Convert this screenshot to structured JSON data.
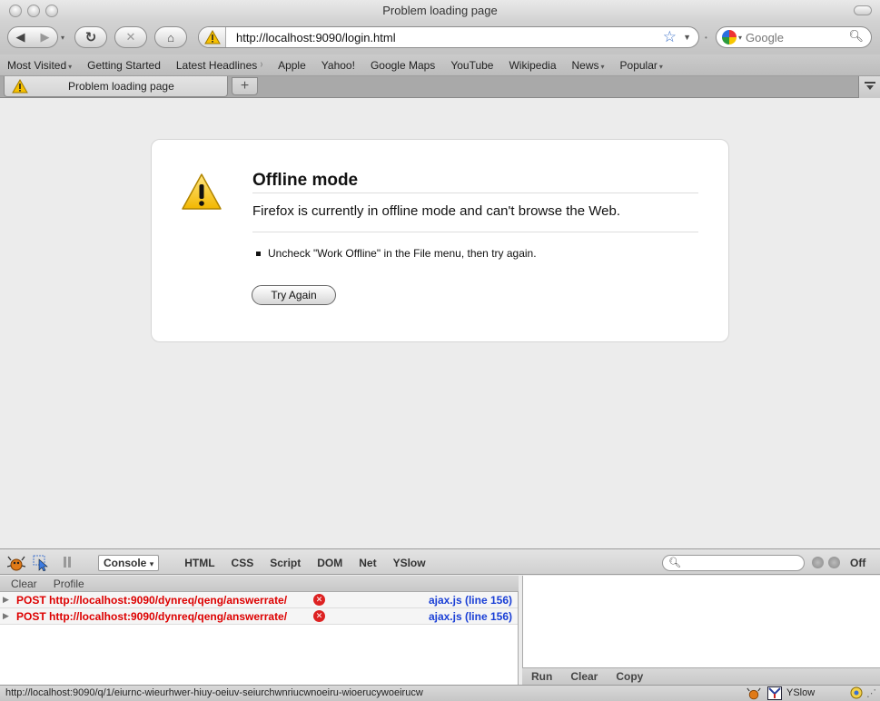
{
  "window": {
    "title": "Problem loading page"
  },
  "toolbar": {
    "url": "http://localhost:9090/login.html",
    "search_placeholder": "Google"
  },
  "bookmarks": [
    {
      "label": "Most Visited",
      "caret": "▾"
    },
    {
      "label": "Getting Started"
    },
    {
      "label": "Latest Headlines",
      "rss": "rss-icon"
    },
    {
      "label": "Apple"
    },
    {
      "label": "Yahoo!"
    },
    {
      "label": "Google Maps"
    },
    {
      "label": "YouTube"
    },
    {
      "label": "Wikipedia"
    },
    {
      "label": "News",
      "caret": "▾"
    },
    {
      "label": "Popular",
      "caret": "▾"
    }
  ],
  "tab": {
    "title": "Problem loading page",
    "new_tab": "+"
  },
  "error": {
    "title": "Offline mode",
    "description": "Firefox is currently in offline mode and can't browse the Web.",
    "item": "Uncheck \"Work Offline\" in the File menu, then try again.",
    "button": "Try Again"
  },
  "firebug": {
    "tabs": [
      "Console",
      "HTML",
      "CSS",
      "Script",
      "DOM",
      "Net",
      "YSlow"
    ],
    "off_label": "Off",
    "sub": {
      "clear": "Clear",
      "profile": "Profile"
    },
    "logs": [
      {
        "message": "POST http://localhost:9090/dynreq/qeng/answerrate/",
        "source": "ajax.js (line 156)"
      },
      {
        "message": "POST http://localhost:9090/dynreq/qeng/answerrate/",
        "source": "ajax.js (line 156)"
      }
    ],
    "right": {
      "run": "Run",
      "clear": "Clear",
      "copy": "Copy"
    }
  },
  "status": {
    "text": "http://localhost:9090/q/1/eiurnc-wieurhwer-hiuy-oeiuv-seiurchwnriucwnoeiru-wioerucywoeirucw",
    "yslow": "YSlow"
  },
  "colors": {
    "error_red": "#dd0000",
    "link_blue": "#1a3fd6",
    "warning_yellow": "#f6c000"
  }
}
